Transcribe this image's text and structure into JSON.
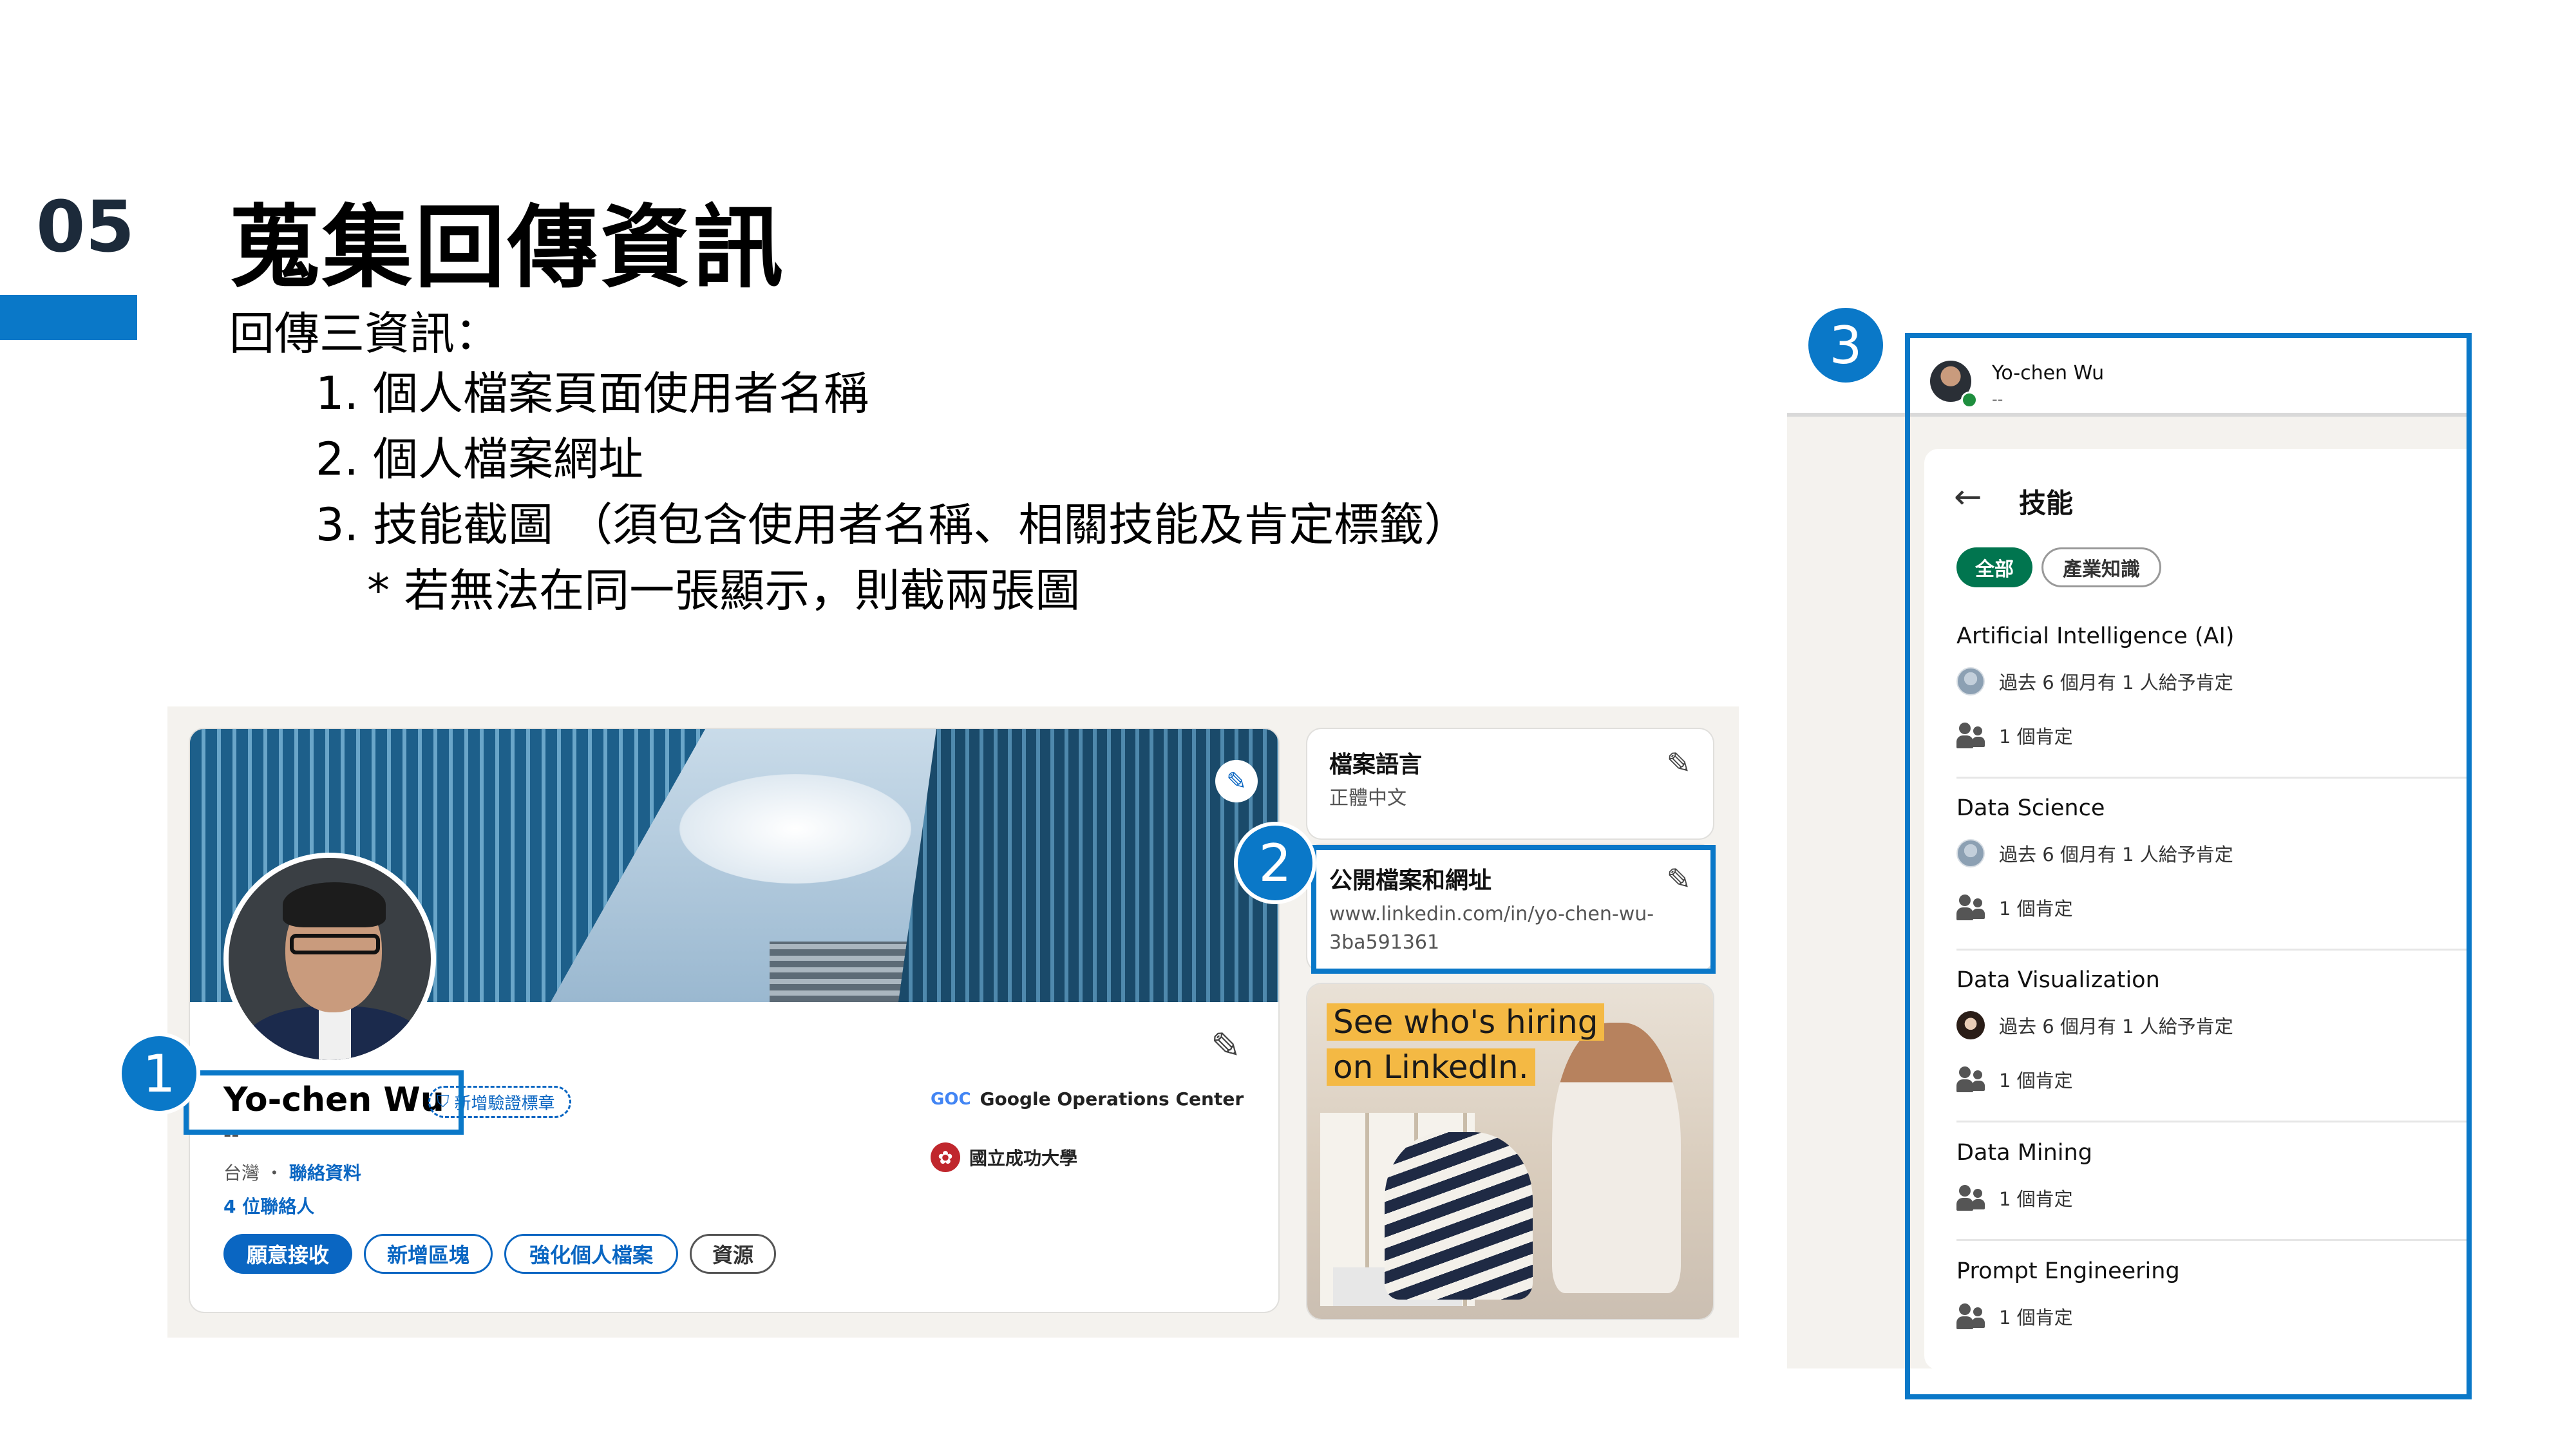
{
  "slide": {
    "number": "05",
    "title": "蒐集回傳資訊",
    "intro": "回傳三資訊：",
    "steps": [
      "1. 個人檔案頁面使用者名稱",
      "2. 個人檔案網址",
      "3. 技能截圖 （須包含使用者名稱、相關技能及肯定標籤）"
    ],
    "note": "* 若無法在同一張顯示，則截兩張圖"
  },
  "markers": [
    "1",
    "2",
    "3"
  ],
  "profile": {
    "name": "Yo-chen Wu",
    "verify_badge": "新增驗證標章",
    "headline": "--",
    "location": "台灣 ・",
    "contact_link": "聯絡資料",
    "connections": "4 位聯絡人",
    "buttons": {
      "open_to": "願意接收",
      "add_section": "新增區塊",
      "enhance": "強化個人檔案",
      "resources": "資源"
    },
    "orgs": [
      {
        "logo": "GOC",
        "name": "Google Operations Center"
      },
      {
        "logo": "✿",
        "name": "國立成功大學"
      }
    ]
  },
  "side_cards": {
    "language": {
      "title": "檔案語言",
      "value": "正體中文"
    },
    "public_url": {
      "title": "公開檔案和網址",
      "value": "www.linkedin.com/in/yo-chen-wu-3ba591361"
    }
  },
  "ad": {
    "line1": "See who's hiring",
    "line2": "on LinkedIn."
  },
  "skills_panel": {
    "user_name": "Yo-chen Wu",
    "user_sub": "--",
    "title": "技能",
    "filters": {
      "all": "全部",
      "industry": "產業知識"
    },
    "skills": [
      {
        "name": "Artificial Intelligence (AI)",
        "endorser": "過去 6 個月有 1 人給予肯定",
        "endorser_icon": "person-avatar-icon",
        "count": "1 個肯定"
      },
      {
        "name": "Data Science",
        "endorser": "過去 6 個月有 1 人給予肯定",
        "endorser_icon": "person-avatar-icon",
        "count": "1 個肯定"
      },
      {
        "name": "Data Visualization",
        "endorser": "過去 6 個月有 1 人給予肯定",
        "endorser_icon": "woman-avatar-icon",
        "count": "1 個肯定"
      },
      {
        "name": "Data Mining",
        "count": "1 個肯定"
      },
      {
        "name": "Prompt Engineering",
        "count": "1 個肯定"
      }
    ]
  },
  "colors": {
    "accent": "#0a78c8",
    "linkedin_blue": "#0a66c2",
    "chip_green": "#01754f",
    "ad_yellow": "#f4b944"
  }
}
